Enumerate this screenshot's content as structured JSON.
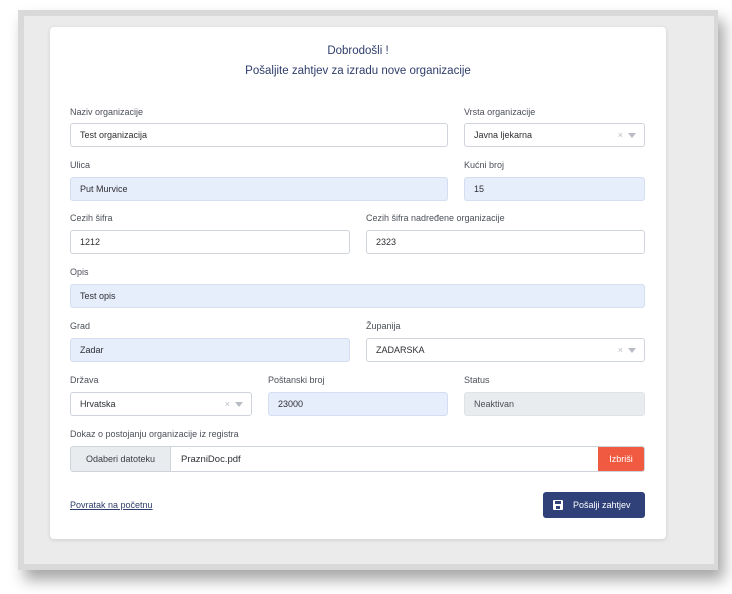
{
  "header": {
    "greeting": "Dobrodošli !",
    "subtitle": "Pošaljite zahtjev za izradu nove organizacije"
  },
  "form": {
    "naziv": {
      "label": "Naziv organizacije",
      "value": "Test organizacija"
    },
    "vrsta": {
      "label": "Vrsta organizacije",
      "value": "Javna ljekarna"
    },
    "ulica": {
      "label": "Ulica",
      "value": "Put Murvice"
    },
    "kucni_broj": {
      "label": "Kućni broj",
      "value": "15"
    },
    "cezih": {
      "label": "Cezih šifra",
      "value": "1212"
    },
    "cezih_nadredene": {
      "label": "Cezih šifra nadređene organizacije",
      "value": "2323"
    },
    "opis": {
      "label": "Opis",
      "value": "Test opis"
    },
    "grad": {
      "label": "Grad",
      "value": "Zadar"
    },
    "zupanija": {
      "label": "Županija",
      "value": "ZADARSKA"
    },
    "drzava": {
      "label": "Država",
      "value": "Hrvatska"
    },
    "postanski": {
      "label": "Poštanski broj",
      "value": "23000"
    },
    "status": {
      "label": "Status",
      "value": "Neaktivan"
    },
    "dokaz": {
      "label": "Dokaz o postojanju organizacije iz registra",
      "choose_label": "Odaberi datoteku",
      "file_name": "PrazniDoc.pdf",
      "delete_label": "Izbriši"
    }
  },
  "footer": {
    "back_link": "Povratak na početnu",
    "submit_label": "Pošalji zahtjev"
  },
  "icons": {
    "clear": "×",
    "submit_icon": "save-icon"
  },
  "colors": {
    "primary": "#2f4178",
    "danger": "#f05a41",
    "prefilled_bg": "#e6edfb",
    "disabled_bg": "#e9ecef"
  }
}
